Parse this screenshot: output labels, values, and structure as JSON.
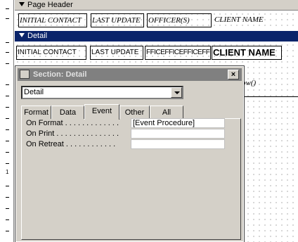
{
  "sections": {
    "page_header": "Page Header",
    "detail": "Detail"
  },
  "header_controls": [
    "INITIAL CONTACT",
    "LAST UPDATE",
    "OFFICER(S)",
    "CLIENT NAME"
  ],
  "detail_controls": [
    "INITIAL CONTACT",
    "LAST UPDATE",
    "FFICEFFICEFFICEFFICE",
    "CLIENT NAME"
  ],
  "footer_fragment": "ow()",
  "ruler": {
    "label_1": "1"
  },
  "dialog": {
    "title": "Section: Detail",
    "close_label": "×",
    "selector_value": "Detail",
    "tabs": [
      "Format",
      "Data",
      "Event",
      "Other",
      "All"
    ],
    "active_tab": "Event",
    "properties": [
      {
        "label": "On Format . . . . . . . . . . . . .",
        "value": "[Event Procedure]"
      },
      {
        "label": "On Print . . . . . . . . . . . . . . .",
        "value": ""
      },
      {
        "label": "On Retreat . . . . . . . . . . . .",
        "value": ""
      }
    ]
  },
  "colors": {
    "detail_bar": "#0a246a",
    "dialog_face": "#d4d0c8",
    "inactive_title": "#808080"
  }
}
